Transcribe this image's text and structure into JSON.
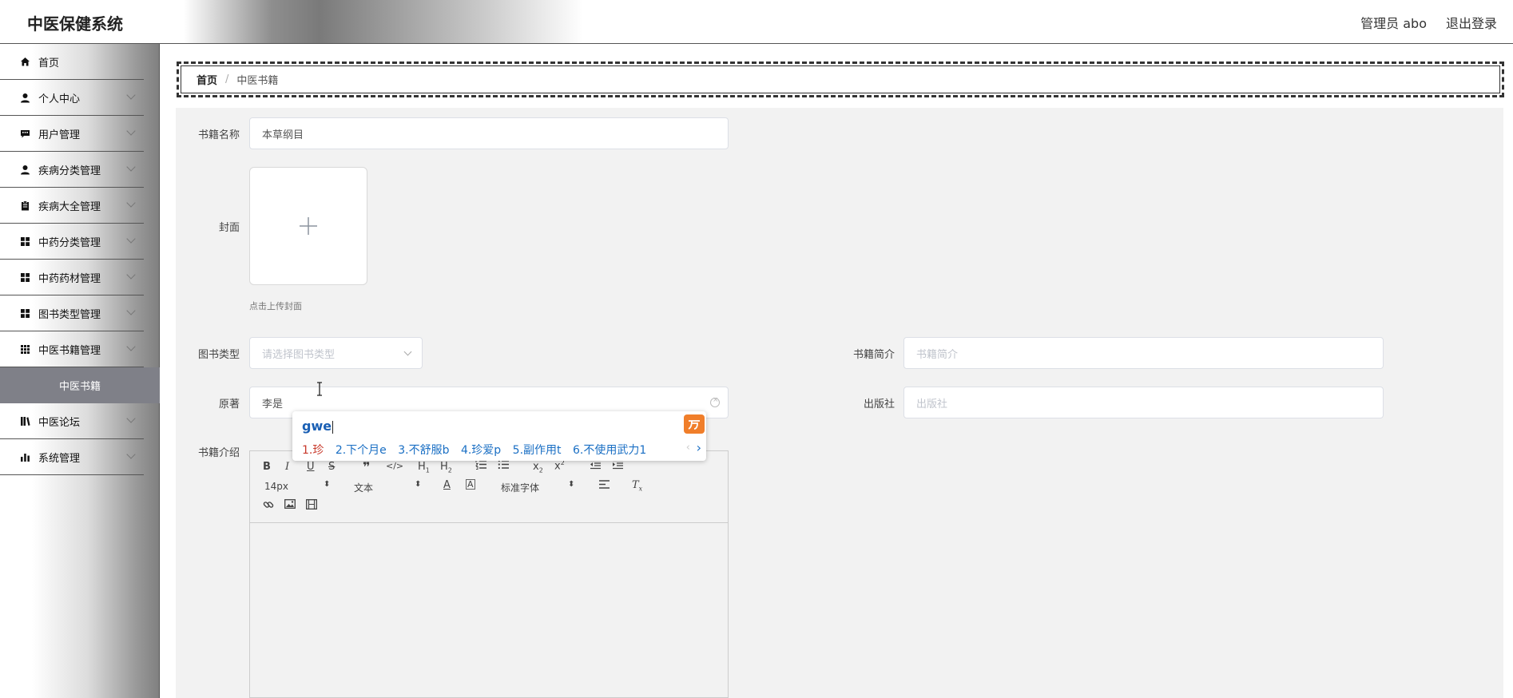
{
  "header": {
    "app_title": "中医保健系统",
    "user_label": "管理员 abo",
    "logout_label": "退出登录"
  },
  "sidebar": {
    "items": [
      {
        "label": "首页",
        "icon": "home-icon",
        "has_submenu": false
      },
      {
        "label": "个人中心",
        "icon": "user-icon",
        "has_submenu": true
      },
      {
        "label": "用户管理",
        "icon": "message-icon",
        "has_submenu": true
      },
      {
        "label": "疾病分类管理",
        "icon": "user-icon",
        "has_submenu": true
      },
      {
        "label": "疾病大全管理",
        "icon": "clipboard-icon",
        "has_submenu": true
      },
      {
        "label": "中药分类管理",
        "icon": "grid-icon",
        "has_submenu": true
      },
      {
        "label": "中药药材管理",
        "icon": "grid-icon",
        "has_submenu": true
      },
      {
        "label": "图书类型管理",
        "icon": "grid-icon",
        "has_submenu": true
      },
      {
        "label": "中医书籍管理",
        "icon": "apps-icon",
        "has_submenu": true
      },
      {
        "label": "中医论坛",
        "icon": "library-icon",
        "has_submenu": true
      },
      {
        "label": "系统管理",
        "icon": "bar-chart-icon",
        "has_submenu": true
      }
    ],
    "active_subitem": "中医书籍"
  },
  "breadcrumb": {
    "home": "首页",
    "separator": "/",
    "current": "中医书籍"
  },
  "form": {
    "name_label": "书籍名称",
    "name_value": "本草纲目",
    "cover_label": "封面",
    "cover_tip": "点击上传封面",
    "type_label": "图书类型",
    "type_placeholder": "请选择图书类型",
    "intro_short_label": "书籍简介",
    "intro_short_placeholder": "书籍简介",
    "author_label": "原著",
    "author_value": "李是",
    "publisher_label": "出版社",
    "publisher_placeholder": "出版社",
    "description_label": "书籍介绍"
  },
  "editor": {
    "font_size": "14px",
    "format": "文本",
    "font_family": "标准字体"
  },
  "ime": {
    "input": "gwe",
    "candidates": [
      "1.珍",
      "2.下个月e",
      "3.不舒服b",
      "4.珍爱p",
      "5.副作用t",
      "6.不使用武力1"
    ]
  },
  "colors": {
    "sidebar_active_bg": "#7f8088",
    "ime_logo": "#f07e2a",
    "ime_candidate": "#1a6fc4",
    "ime_first_candidate": "#c8392b"
  }
}
